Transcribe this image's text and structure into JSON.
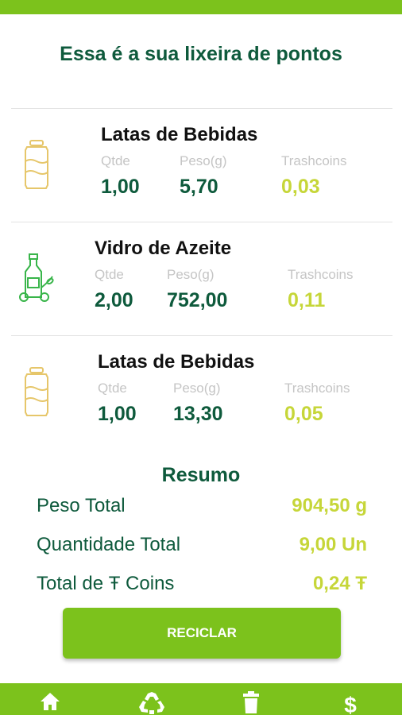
{
  "header": {
    "title": "Essa é a sua lixeira de pontos"
  },
  "items": [
    {
      "name": "Latas de Bebidas",
      "icon": "can-icon",
      "qty_label": "Qtde",
      "weight_label": "Peso(g)",
      "coins_label": "Trashcoins",
      "qty": "1,00",
      "weight": "5,70",
      "coins": "0,03"
    },
    {
      "name": "Vidro de Azeite",
      "icon": "olive-oil-bottle-icon",
      "qty_label": "Qtde",
      "weight_label": "Peso(g)",
      "coins_label": "Trashcoins",
      "qty": "2,00",
      "weight": "752,00",
      "coins": "0,11"
    },
    {
      "name": "Latas de Bebidas",
      "icon": "can-icon",
      "qty_label": "Qtde",
      "weight_label": "Peso(g)",
      "coins_label": "Trashcoins",
      "qty": "1,00",
      "weight": "13,30",
      "coins": "0,05"
    }
  ],
  "summary": {
    "title": "Resumo",
    "rows": [
      {
        "label": "Peso Total",
        "value": "904,50 g"
      },
      {
        "label": "Quantidade Total",
        "value": "9,00 Un"
      },
      {
        "label": "Total de Ŧ Coins",
        "value": "0,24 Ŧ"
      }
    ]
  },
  "actions": {
    "recycle_label": "RECICLAR"
  },
  "bottom_nav": [
    {
      "icon": "home-icon"
    },
    {
      "icon": "recycle-icon"
    },
    {
      "icon": "trash-icon"
    },
    {
      "icon": "dollar-icon"
    }
  ],
  "colors": {
    "brand_green": "#7cc21c",
    "dark_green": "#0e5a3c",
    "coin_yellow": "#c6d639",
    "can_gold": "#e6c66a",
    "bottle_green": "#39b54a"
  }
}
